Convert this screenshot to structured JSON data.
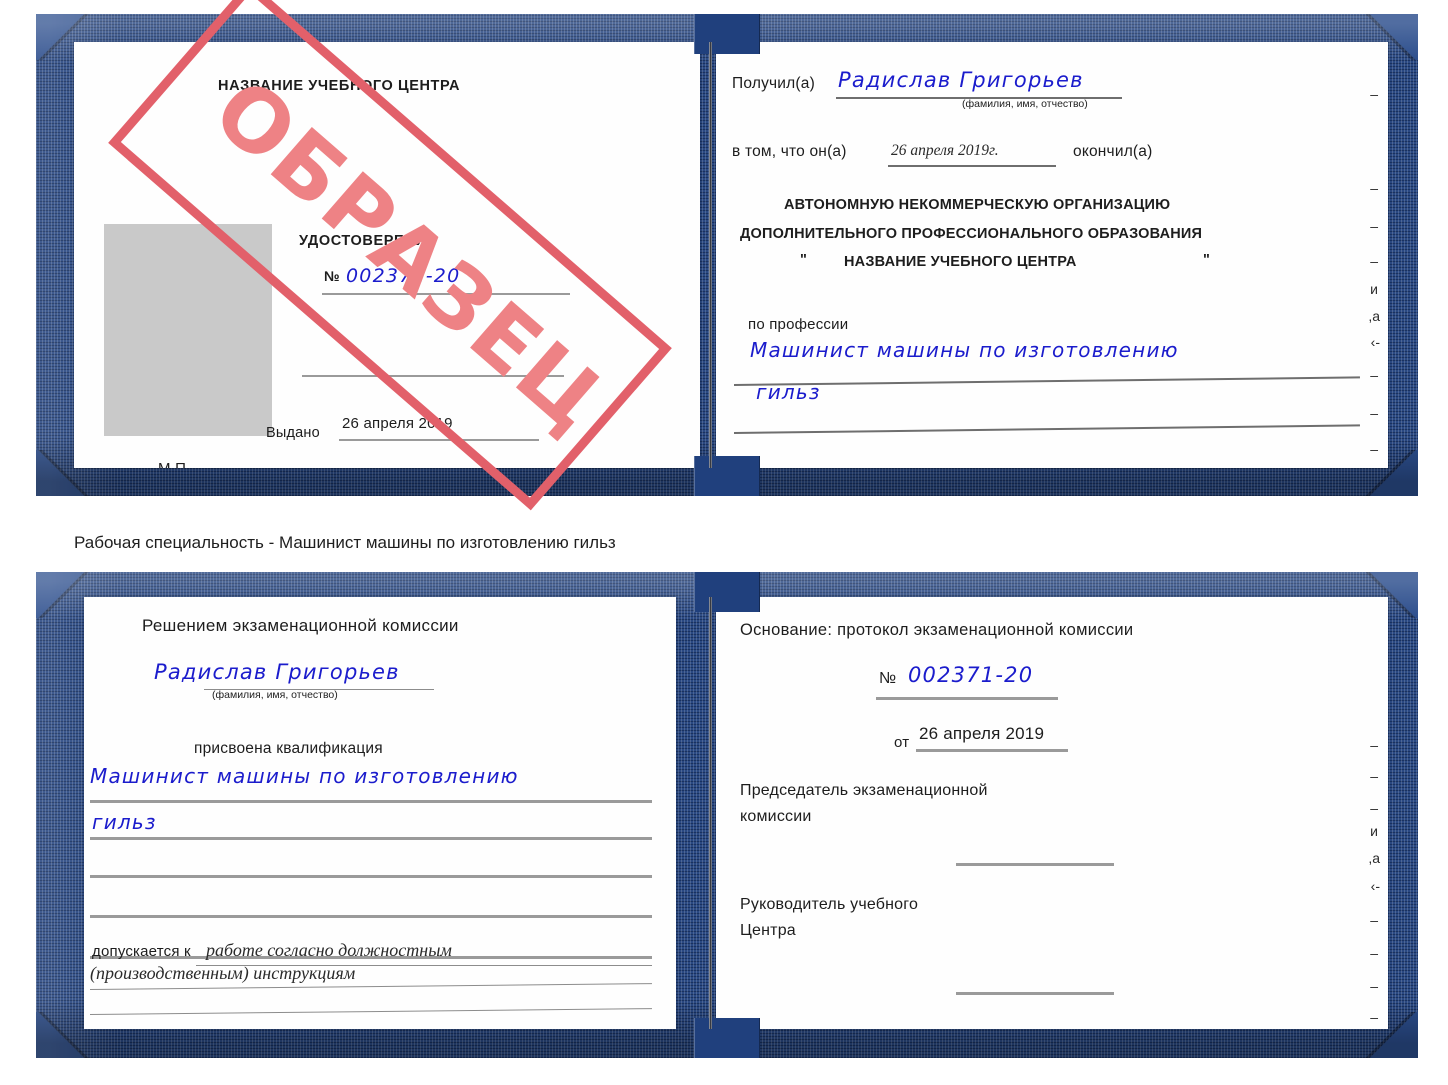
{
  "caption": {
    "text": "Рабочая специальность - Машинист машины по изготовлению гильз"
  },
  "colors": {
    "cover_blue": "#1f3f7c",
    "page_white": "#fefefe",
    "handwriting_blue": "#1b1ccc",
    "stamp_border_red": "#e2606a",
    "stamp_text_red": "#ee8285",
    "photo_gray": "#c9c9c9",
    "rule_gray": "#9a9a9a"
  },
  "stamp": {
    "label": "ОБРАЗЕЦ"
  },
  "certificate_top": {
    "left_page": {
      "center_name_header": "НАЗВАНИЕ УЧЕБНОГО ЦЕНТРА",
      "doc_title": "УДОСТОВЕРЕНИЕ",
      "number_label": "№",
      "number_value": "002371-20",
      "issued_label": "Выдано",
      "issued_value": "26 апреля 2019",
      "seal_label": "М.П."
    },
    "right_page": {
      "received_label": "Получил(а)",
      "received_value": "Радислав Григорьев",
      "received_hint": "(фамилия, имя, отчество)",
      "in_that_label": "в том, что он(а)",
      "in_that_value": "26 апреля 2019г.",
      "finished_label": "окончил(а)",
      "org_line1": "АВТОНОМНУЮ НЕКОММЕРЧЕСКУЮ ОРГАНИЗАЦИЮ",
      "org_line2": "ДОПОЛНИТЕЛЬНОГО ПРОФЕССИОНАЛЬНОГО ОБРАЗОВАНИЯ",
      "org_quote_open": "\"",
      "org_line3": "НАЗВАНИЕ УЧЕБНОГО ЦЕНТРА",
      "org_quote_close": "\"",
      "profession_label": "по профессии",
      "profession_value_line1": "Машинист машины по изготовлению",
      "profession_value_line2": "гильз",
      "edge_fragments": [
        "–",
        "–",
        "–",
        "–",
        "и",
        ",а",
        "‹-",
        "–",
        "–",
        "–"
      ]
    }
  },
  "certificate_bottom": {
    "left_page": {
      "decision_header": "Решением экзаменационной комиссии",
      "name_value": "Радислав Григорьев",
      "name_hint": "(фамилия, имя, отчество)",
      "qualification_label": "присвоена квалификация",
      "qualification_value_line1": "Машинист машины по изготовлению",
      "qualification_value_line2": "гильз",
      "admitted_label": "допускается к",
      "admitted_value_line1": "работе согласно должностным",
      "admitted_value_line2": "(производственным) инструкциям"
    },
    "right_page": {
      "basis_label": "Основание: протокол экзаменационной комиссии",
      "number_label": "№",
      "number_value": "002371-20",
      "date_label": "от",
      "date_value": "26 апреля 2019",
      "chairman_line1": "Председатель экзаменационной",
      "chairman_line2": "комиссии",
      "head_line1": "Руководитель учебного",
      "head_line2": "Центра",
      "edge_fragments": [
        "–",
        "–",
        "–",
        "и",
        ",а",
        "‹-",
        "–",
        "–",
        "–",
        "–"
      ]
    }
  }
}
